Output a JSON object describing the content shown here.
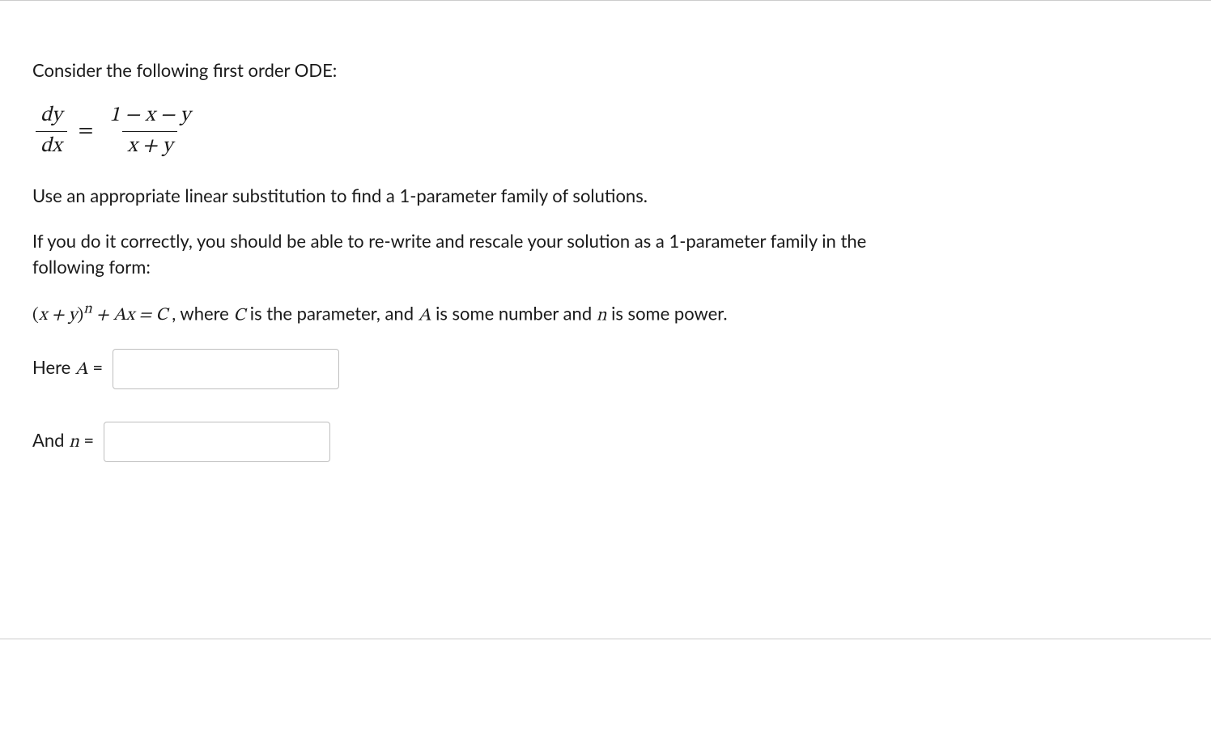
{
  "question": {
    "intro": "Consider the following first order ODE:",
    "ode": {
      "lhs_num": "dy",
      "lhs_den": "dx",
      "equals": "=",
      "rhs_num": "1 − x − y",
      "rhs_den": "x + y"
    },
    "instruction1": "Use an appropriate linear substitution to find a 1-parameter family of solutions.",
    "instruction2": "If you do it correctly, you should be able to re-write and rescale your solution as a 1-parameter family in the following form:",
    "solution_form": {
      "expr_prefix": "(x + y)",
      "expr_power": "n",
      "expr_mid": " + Ax = C",
      "desc_before_C": ", where ",
      "C": "C",
      "desc_after_C": " is the parameter, and ",
      "A": "A",
      "desc_after_A": " is some number and ",
      "n": "n",
      "desc_end": " is some power."
    },
    "answer_A": {
      "label_pre": "Here ",
      "var": "A",
      "label_post": " ="
    },
    "answer_n": {
      "label_pre": "And ",
      "var": "n",
      "label_post": " ="
    },
    "input_A_value": "",
    "input_n_value": ""
  }
}
